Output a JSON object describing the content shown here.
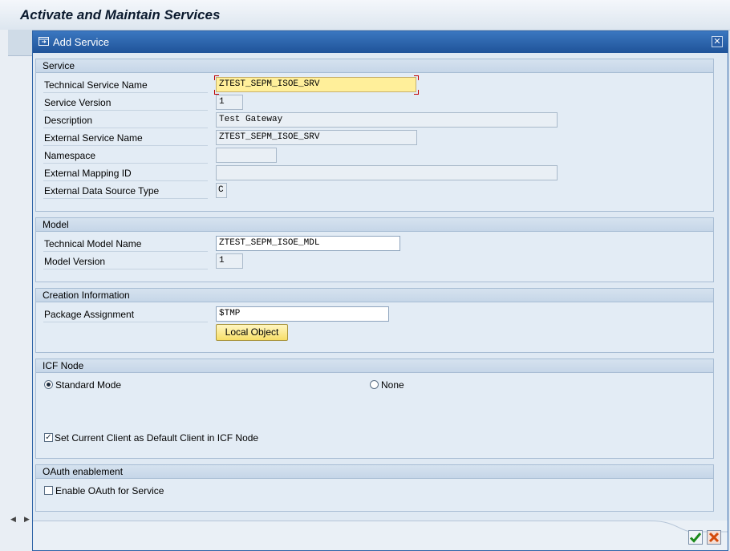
{
  "app": {
    "title": "Activate and Maintain Services"
  },
  "dialog": {
    "title": "Add Service",
    "close_glyph": "✕"
  },
  "service": {
    "header": "Service",
    "technical_service_name": {
      "label": "Technical Service Name",
      "value": "ZTEST_SEPM_ISOE_SRV"
    },
    "service_version": {
      "label": "Service Version",
      "value": "1"
    },
    "description": {
      "label": "Description",
      "value": "Test Gateway"
    },
    "external_service_name": {
      "label": "External Service Name",
      "value": "ZTEST_SEPM_ISOE_SRV"
    },
    "namespace": {
      "label": "Namespace",
      "value": ""
    },
    "external_mapping_id": {
      "label": "External Mapping ID",
      "value": ""
    },
    "external_data_source_type": {
      "label": "External Data Source Type",
      "value": "C"
    }
  },
  "model": {
    "header": "Model",
    "technical_model_name": {
      "label": "Technical Model Name",
      "value": "ZTEST_SEPM_ISOE_MDL"
    },
    "model_version": {
      "label": "Model Version",
      "value": "1"
    }
  },
  "creation": {
    "header": "Creation Information",
    "package_assignment": {
      "label": "Package Assignment",
      "value": "$TMP"
    },
    "local_object_button": "Local Object"
  },
  "icf": {
    "header": "ICF Node",
    "standard_mode": {
      "label": "Standard Mode",
      "selected": true
    },
    "none": {
      "label": "None",
      "selected": false
    },
    "set_default_client": {
      "label": "Set Current Client as Default Client in ICF Node",
      "checked": true
    }
  },
  "oauth": {
    "header": "OAuth enablement",
    "enable_oauth": {
      "label": "Enable OAuth for Service",
      "checked": false
    }
  },
  "footer": {
    "ok_icon": "checkmark-icon",
    "cancel_icon": "cancel-x-icon"
  },
  "colors": {
    "dialog_title_bar": "#2a63ad",
    "focus_field": "#ffef9a",
    "local_object_button": "#f7de67"
  }
}
